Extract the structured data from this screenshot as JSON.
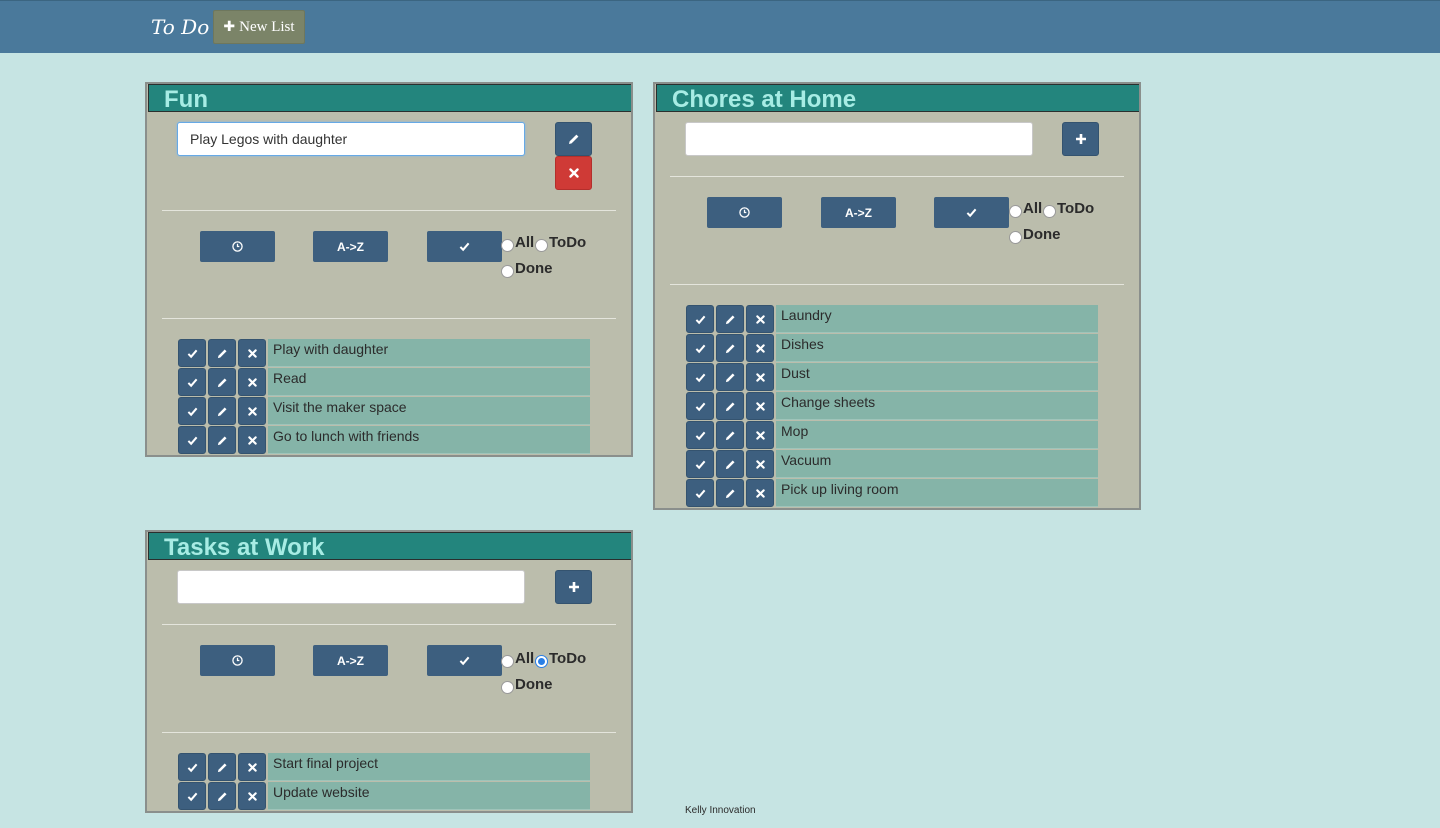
{
  "navbar": {
    "brand": "To Do",
    "new_list_label": "New List"
  },
  "colors": {
    "navbar": "#4a799b",
    "background": "#c6e4e3",
    "panel": "#bbbdac",
    "header": "#23857d",
    "title": "#a7ece4",
    "button": "#3d5f7f",
    "delete": "#cf3a36",
    "task": "#85b4a8"
  },
  "sort_labels": {
    "az": "A->Z"
  },
  "filter_labels": {
    "all": "All",
    "todo": "ToDo",
    "done": "Done"
  },
  "lists": [
    {
      "title": "Fun",
      "input_value": "Play Legos with daughter",
      "mode": "edit",
      "filter": "none",
      "tasks": [
        "Play with daughter",
        "Read",
        "Visit the maker space",
        "Go to lunch with friends"
      ]
    },
    {
      "title": "Chores at Home",
      "input_value": "",
      "mode": "add",
      "filter": "none",
      "tasks": [
        "Laundry",
        "Dishes",
        "Dust",
        "Change sheets",
        "Mop",
        "Vacuum",
        "Pick up living room"
      ]
    },
    {
      "title": "Tasks at Work",
      "input_value": "",
      "mode": "add",
      "filter": "todo",
      "tasks": [
        "Start final project",
        "Update website"
      ]
    }
  ],
  "footer": {
    "text": "Kelly Innovation"
  }
}
